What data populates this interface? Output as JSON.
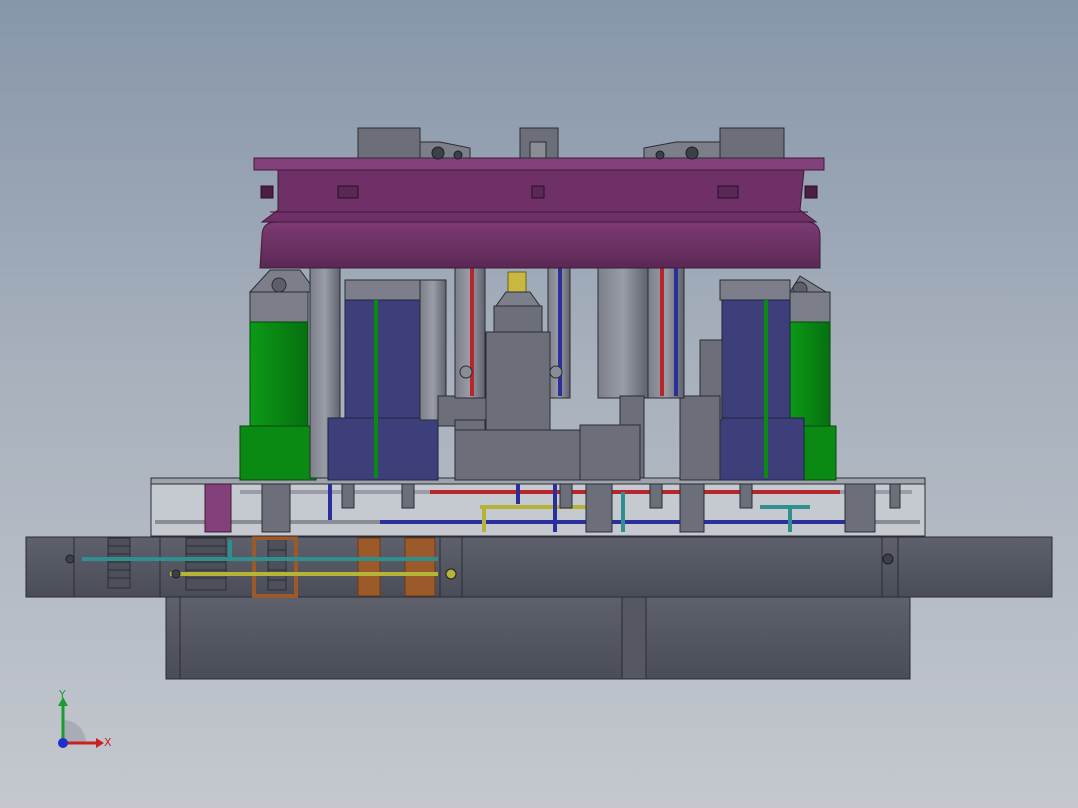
{
  "viewport": {
    "background_top": "#8796aa",
    "background_bottom": "#c4c8ce"
  },
  "model": {
    "colors": {
      "steel": "#5c5f6a",
      "steel_dark": "#3d4049",
      "steel_light": "#8a8d96",
      "top_clamp": "#6b2f63",
      "top_clamp_light": "#84407b",
      "cylinder_green": "#0a8a12",
      "cylinder_navy": "#3c3f7a",
      "pipe_red": "#b8262c",
      "pipe_blue": "#2a2f9c",
      "pipe_yellow": "#b5b338",
      "pipe_teal": "#2f8f8f",
      "spring_brown": "#9c5a2a",
      "glass_plate": "#c9ccd2"
    }
  },
  "triad": {
    "x_label": "X",
    "y_label": "Y",
    "x_color": "#cc1f1f",
    "y_color": "#1f9a2f",
    "z_color": "#1f2fcc"
  }
}
